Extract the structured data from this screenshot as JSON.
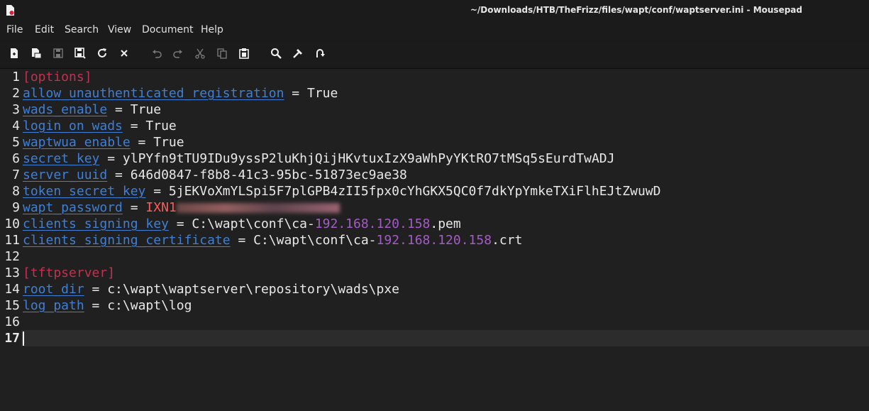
{
  "window": {
    "title": "~/Downloads/HTB/TheFrizz/files/wapt/conf/waptserver.ini - Mousepad"
  },
  "menu": [
    "File",
    "Edit",
    "Search",
    "View",
    "Document",
    "Help"
  ],
  "toolbar_icons": [
    "new-document-icon",
    "new-window-icon",
    "save-icon",
    "save-as-icon",
    "reload-icon",
    "close-icon",
    "undo-icon",
    "redo-icon",
    "cut-icon",
    "copy-icon",
    "paste-icon",
    "find-icon",
    "find-replace-icon",
    "goto-icon"
  ],
  "editor": {
    "current_line": 17,
    "lines": [
      {
        "n": "1",
        "section": "[options]"
      },
      {
        "n": "2",
        "key": "allow_unauthenticated_registration",
        "eq": " = ",
        "value": "True"
      },
      {
        "n": "3",
        "key": "wads_enable",
        "eq": " = ",
        "value": "True"
      },
      {
        "n": "4",
        "key": "login_on_wads",
        "eq": " = ",
        "value": "True"
      },
      {
        "n": "5",
        "key": "waptwua_enable",
        "eq": " = ",
        "value": "True"
      },
      {
        "n": "6",
        "key": "secret_key",
        "eq": " = ",
        "value": "ylPYfn9tTU9IDu9yssP2luKhjQijHKvtuxIzX9aWhPyYKtRO7tMSq5sEurdTwADJ"
      },
      {
        "n": "7",
        "key": "server_uuid",
        "eq": " = ",
        "value": "646d0847-f8b8-41c3-95bc-51873ec9ae38"
      },
      {
        "n": "8",
        "key": "token_secret_key",
        "eq": " = ",
        "value": "5jEKVoXmYLSpi5F7plGPB4zII5fpx0cYhGKX5QC0f7dkYpYmkeTXiFlhEJtZwuwD"
      },
      {
        "n": "9",
        "key": "wapt_password",
        "eq": " = ",
        "value_visible": "IXN1"
      },
      {
        "n": "10",
        "key": "clients_signing_key",
        "eq": " = ",
        "prefix": "C:\\wapt\\conf\\ca-",
        "ip": "192.168.120.158",
        "suffix": ".pem"
      },
      {
        "n": "11",
        "key": "clients_signing_certificate",
        "eq": " = ",
        "prefix": "C:\\wapt\\conf\\ca-",
        "ip": "192.168.120.158",
        "suffix": ".crt"
      },
      {
        "n": "12"
      },
      {
        "n": "13",
        "section": "[tftpserver]"
      },
      {
        "n": "14",
        "key": "root_dir",
        "eq": " = ",
        "value": "c:\\wapt\\waptserver\\repository\\wads\\pxe"
      },
      {
        "n": "15",
        "key": "log_path",
        "eq": " = ",
        "value": "c:\\wapt\\log"
      },
      {
        "n": "16"
      },
      {
        "n": "17"
      }
    ]
  },
  "colors": {
    "section": "#c4304f",
    "key": "#3f7fd6",
    "ip": "#a45bc6",
    "password": "#ff5a5a"
  }
}
